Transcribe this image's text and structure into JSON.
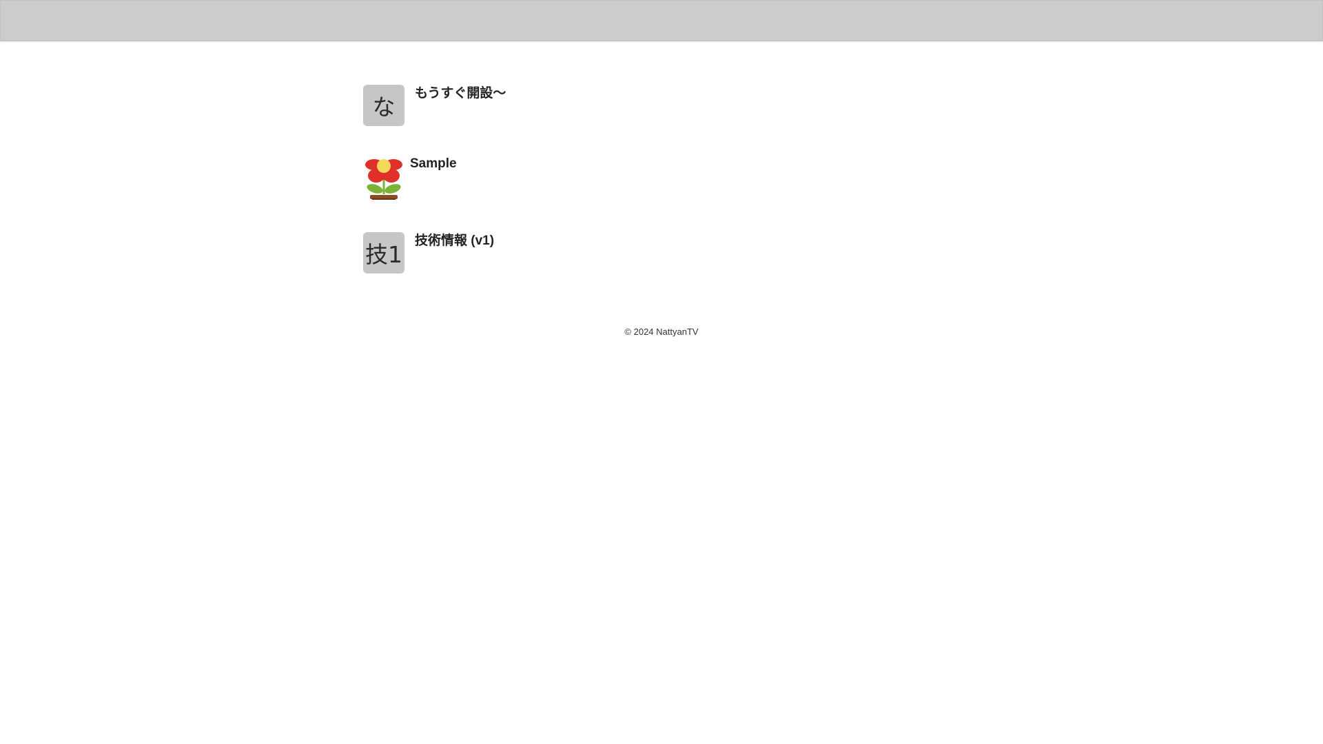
{
  "items": [
    {
      "avatar_text": "な",
      "title": "もうすぐ開設〜"
    },
    {
      "avatar_icon": "flower-pot-icon",
      "title": "Sample"
    },
    {
      "avatar_text": "技1",
      "title": "技術情報 (v1)"
    }
  ],
  "footer": {
    "copyright": "© 2024 NattyanTV"
  },
  "colors": {
    "topbar": "#cccccc",
    "avatar_bg": "#c6c6c6",
    "petal_red": "#e0302a",
    "flower_center": "#f5d85a",
    "leaf_green": "#7ab23a",
    "pot_brown": "#8a4a22"
  }
}
